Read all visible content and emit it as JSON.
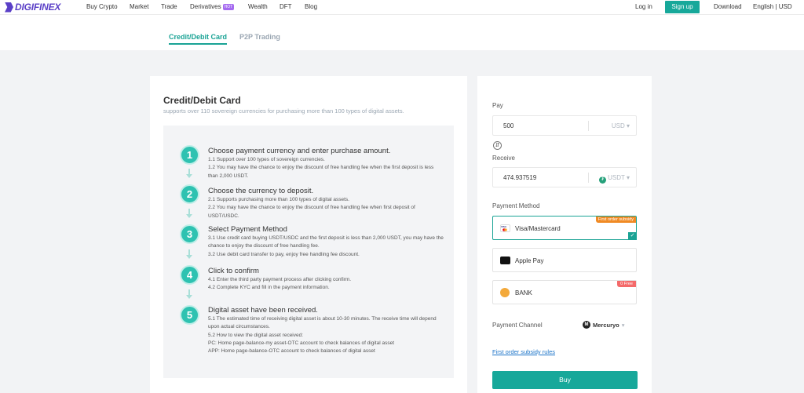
{
  "topnav": {
    "logo_text": "DIGIFINEX",
    "items": [
      "Buy Crypto",
      "Market",
      "Trade",
      "Derivatives",
      "Wealth",
      "DFT",
      "Blog"
    ],
    "hot_badge": "HOT",
    "login": "Log in",
    "signup": "Sign up",
    "download": "Download",
    "lang_currency": "English | USD"
  },
  "subnav": {
    "tabs": [
      "Credit/Debit Card",
      "P2P Trading"
    ],
    "active": 0
  },
  "left": {
    "title": "Credit/Debit Card",
    "subtitle": "supports over 110 sovereign currencies for purchasing more than 100 types of digital assets.",
    "steps": [
      {
        "num": "1",
        "title": "Choose payment currency and enter purchase amount.",
        "desc": [
          "1.1 Support over 100 types of sovereign currencies.",
          "1.2 You may have the chance to enjoy the discount of free handling fee when the first deposit is less than 2,000 USDT."
        ]
      },
      {
        "num": "2",
        "title": "Choose the currency to deposit.",
        "desc": [
          "2.1 Supports purchasing more than 100 types of digital assets.",
          "2.2 You may have the chance to enjoy the discount of free handling fee when first deposit of USDT/USDC."
        ]
      },
      {
        "num": "3",
        "title": "Select Payment Method",
        "desc": [
          "3.1 Use credit card buying USDT/USDC and the first deposit is less than 2,000 USDT, you may have the chance to enjoy the discount of free handling fee.",
          "3.2 Use debit card transfer to pay, enjoy free handling fee discount."
        ]
      },
      {
        "num": "4",
        "title": "Click to confirm",
        "desc": [
          "4.1 Enter the third party payment process after clicking confirm.",
          "4.2 Complete KYC and fill in the payment information."
        ]
      },
      {
        "num": "5",
        "title": "Digital asset have been received.",
        "desc": [
          "5.1 The estimated time of receiving digital asset is about 10-30 minutes. The receive time will depend upon actual circumstances.",
          "5.2 How to view the digital asset received:",
          "PC: Home page-balance-my asset-OTC account to check balances of digital asset",
          "APP: Home page-balance-OTC account to check balances of digital asset"
        ]
      }
    ]
  },
  "right": {
    "pay_label": "Pay",
    "pay_value": "500",
    "pay_currency": "USD",
    "receive_label": "Receive",
    "receive_value": "474.937519",
    "receive_currency": "USDT",
    "payment_method_label": "Payment Method",
    "methods": [
      {
        "name": "Visa/Mastercard",
        "badge": "First order subsidy",
        "selected": true
      },
      {
        "name": "Apple Pay",
        "badge": "",
        "selected": false
      },
      {
        "name": "BANK",
        "badge": "0 Free",
        "selected": false
      }
    ],
    "channel_label": "Payment Channel",
    "channel_value": "Mercuryo",
    "rules_link": "First order subsidy rules",
    "buy_button": "Buy"
  },
  "colors": {
    "accent": "#17a89a",
    "brand": "#5a3fc7",
    "badge_orange": "#f08a24",
    "badge_red": "#f46a6a",
    "link": "#1a73c8"
  }
}
